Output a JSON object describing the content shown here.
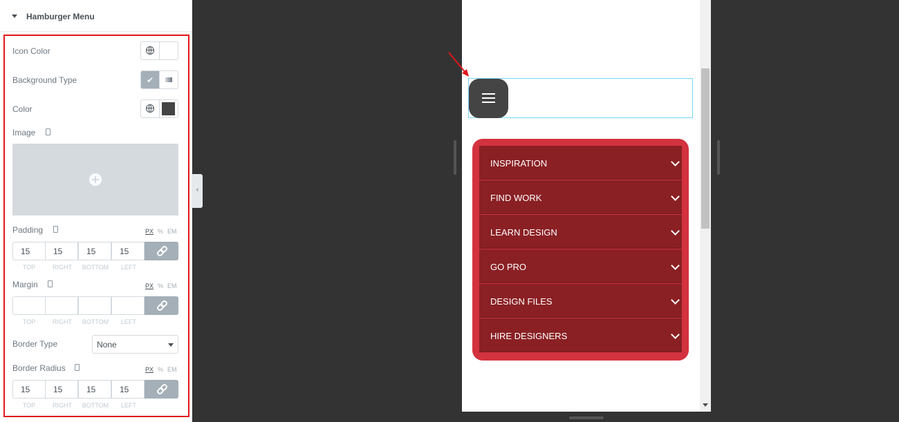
{
  "panel": {
    "section_title": "Hamburger Menu",
    "icon_color_label": "Icon Color",
    "background_type_label": "Background Type",
    "color_label": "Color",
    "color_value": "#444444",
    "image_label": "Image",
    "padding_label": "Padding",
    "margin_label": "Margin",
    "border_type_label": "Border Type",
    "border_type_value": "None",
    "border_radius_label": "Border Radius",
    "units": [
      "PX",
      "%",
      "EM"
    ],
    "dim_labels": [
      "TOP",
      "RIGHT",
      "BOTTOM",
      "LEFT"
    ],
    "padding_values": [
      "15",
      "15",
      "15",
      "15"
    ],
    "margin_values": [
      "",
      "",
      "",
      ""
    ],
    "border_radius_values": [
      "15",
      "15",
      "15",
      "15"
    ]
  },
  "preview": {
    "menu_items": [
      {
        "label": "INSPIRATION"
      },
      {
        "label": "FIND WORK"
      },
      {
        "label": "LEARN DESIGN"
      },
      {
        "label": "GO PRO"
      },
      {
        "label": "DESIGN FILES"
      },
      {
        "label": "HIRE DESIGNERS"
      }
    ],
    "accent_color": "#d3323f",
    "item_color": "#8a2024",
    "hamburger_color": "#444444"
  }
}
